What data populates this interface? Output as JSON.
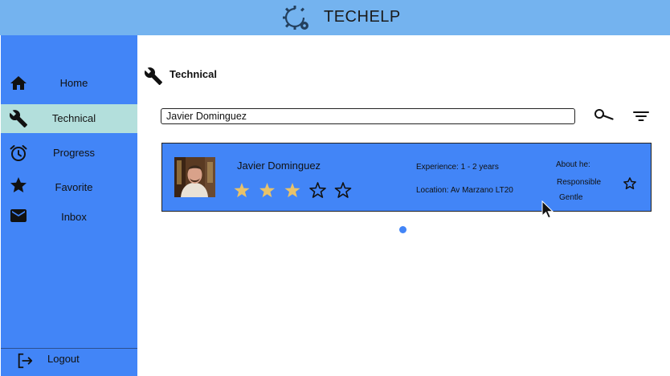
{
  "app": {
    "name": "TECHELP",
    "logo_icon": "gear-refresh-icon"
  },
  "sidebar": {
    "items": [
      {
        "label": "Home",
        "icon": "home-icon",
        "active": false
      },
      {
        "label": "Technical",
        "icon": "wrench-icon",
        "active": true
      },
      {
        "label": "Progress",
        "icon": "alarm-clock-icon",
        "active": false
      },
      {
        "label": "Favorite",
        "icon": "star-icon",
        "active": false
      },
      {
        "label": "Inbox",
        "icon": "mail-icon",
        "active": false
      }
    ],
    "logout_label": "Logout"
  },
  "main": {
    "title": "Technical",
    "search": {
      "value": "Javier Dominguez",
      "placeholder": ""
    }
  },
  "results": [
    {
      "name": "Javier Dominguez",
      "rating": 3,
      "rating_max": 5,
      "experience": "Experience: 1 - 2 years",
      "location": "Location: Av Marzano LT20",
      "about_title": "About he:",
      "traits": [
        "Responsible",
        "Gentle"
      ],
      "favorited": false
    }
  ],
  "pagination": {
    "current": 1,
    "total": 1
  },
  "colors": {
    "topbar": "#74b3ef",
    "sidebar": "#4285f7",
    "active_item": "#b3dfdc",
    "card": "#4285f7",
    "star_filled": "#e8c26a"
  }
}
